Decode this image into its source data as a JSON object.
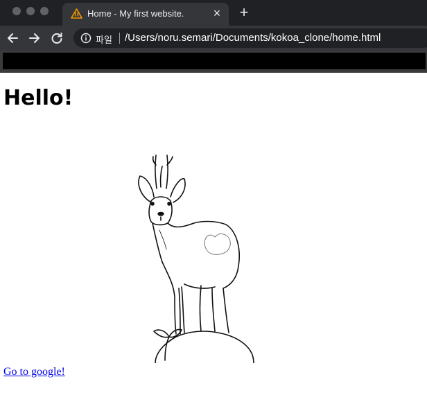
{
  "browser": {
    "tab": {
      "title": "Home - My first website.",
      "icon": "warning-triangle-icon",
      "close_icon": "close-icon"
    },
    "new_tab_icon": "plus-icon",
    "nav": {
      "back_icon": "arrow-left-icon",
      "forward_icon": "arrow-right-icon",
      "reload_icon": "reload-icon"
    },
    "omnibox": {
      "info_icon": "info-icon",
      "scheme_label": "파일",
      "url": "/Users/noru.semari/Documents/kokoa_clone/home.html"
    },
    "colors": {
      "tabstrip": "#202124",
      "toolbar": "#35363a",
      "omnibox": "#202124",
      "warning": "#f29900"
    }
  },
  "page": {
    "heading": "Hello!",
    "image": "deer-illustration",
    "link_text": "Go to google!",
    "colors": {
      "link": "#0000ee"
    }
  }
}
